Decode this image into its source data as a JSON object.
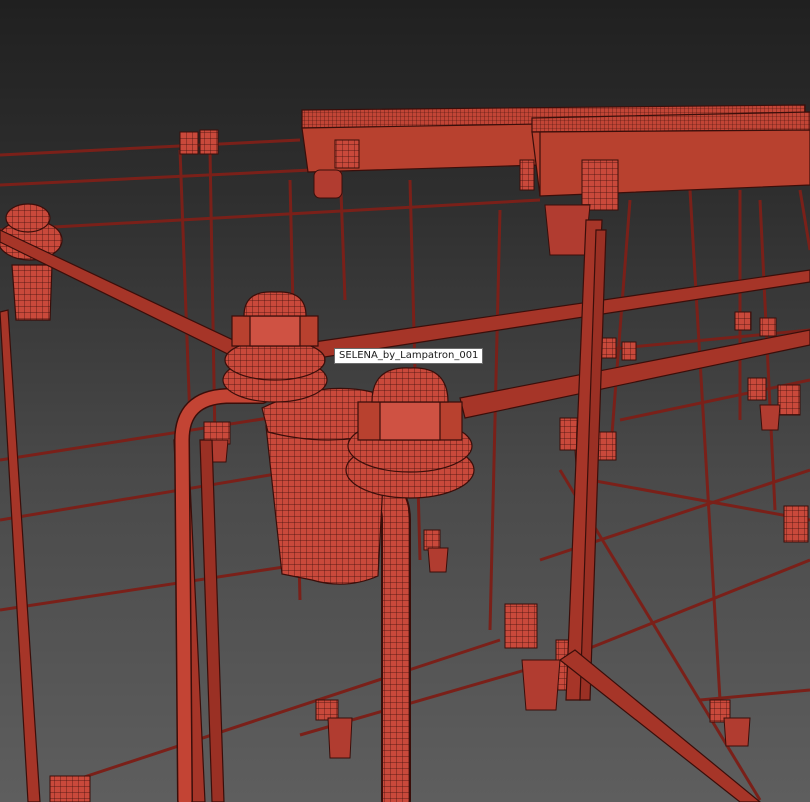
{
  "viewport": {
    "tooltip_text": "SELENA_by_Lampatron_001",
    "background_top": "#202020",
    "background_bottom": "#5e5e5e",
    "wire_color": "#8a2a22",
    "mesh_color": "#c9493b",
    "edge_color": "#3a0e0a"
  }
}
